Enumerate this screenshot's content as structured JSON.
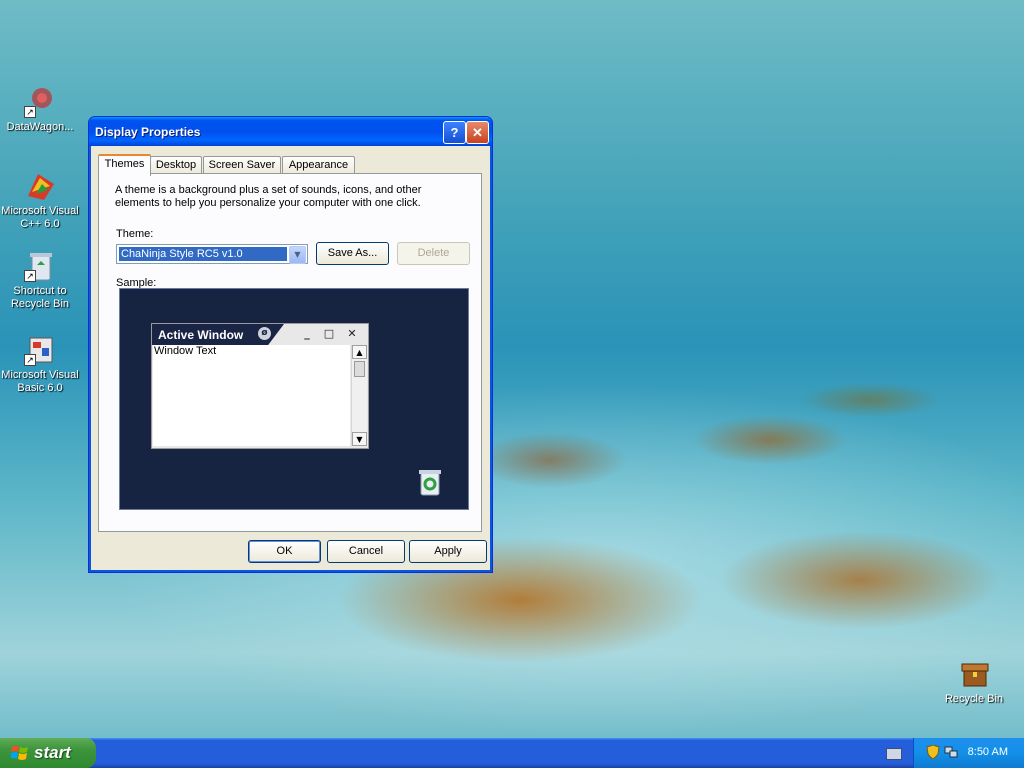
{
  "desktop": {
    "icons": [
      {
        "label": "DataWagon...",
        "icon": "datawagon-icon"
      },
      {
        "label": "Microsoft Visual C++ 6.0",
        "icon": "visual-cpp-icon"
      },
      {
        "label": "Shortcut to Recycle Bin",
        "icon": "recycle-bin-shortcut-icon"
      },
      {
        "label": "Microsoft Visual Basic 6.0",
        "icon": "visual-basic-icon"
      },
      {
        "label": "Recycle Bin",
        "icon": "recycle-bin-icon"
      }
    ]
  },
  "dialog": {
    "title": "Display Properties",
    "help_label": "?",
    "close_label": "✕",
    "tabs": [
      "Themes",
      "Desktop",
      "Screen Saver",
      "Appearance"
    ],
    "active_tab": "Themes",
    "description": "A theme is a background plus a set of sounds, icons, and other elements to help you personalize your computer with one click.",
    "theme_label": "Theme:",
    "theme_value": "ChaNinja Style RC5 v1.0",
    "save_as_label": "Save As...",
    "delete_label": "Delete",
    "sample_label": "Sample:",
    "sample": {
      "window_title": "Active Window",
      "window_text": "Window Text",
      "minimize": "_",
      "maximize": "□",
      "close": "✕"
    },
    "ok_label": "OK",
    "cancel_label": "Cancel",
    "apply_label": "Apply"
  },
  "taskbar": {
    "start_label": "start",
    "clock": "8:50 AM"
  },
  "colors": {
    "title_blue": "#0053ee",
    "taskbar_blue": "#245edb",
    "start_green": "#3c943c",
    "sample_bg": "#172441",
    "selection": "#316ac5"
  }
}
